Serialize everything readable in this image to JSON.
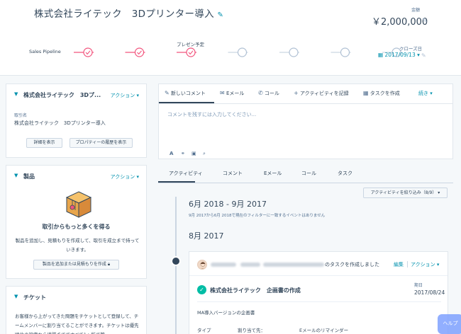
{
  "deal": {
    "title": "株式会社ライテック　3Dプリンター導入"
  },
  "amount": {
    "label": "金額",
    "value": "￥2,000,000"
  },
  "close_date": {
    "label": "クローズ日",
    "value": "2017/09/13"
  },
  "pipeline": {
    "label": "Sales Pipeline",
    "current_stage": "プレゼン予定",
    "stages_done": 3,
    "stages_total": 7
  },
  "deal_card": {
    "title": "株式会社ライテック　3Dプ...",
    "action": "アクション",
    "field_label": "取引名",
    "field_value": "株式会社ライテック　3Dプリンター導入",
    "btn_details": "詳細を表示",
    "btn_history": "プロパティーの履歴を表示"
  },
  "product_card": {
    "title": "製品",
    "action": "アクション",
    "empty_title": "取引からもっと多くを得る",
    "empty_desc": "製品を追加し、見積もりを作成して、取引を成立まで持っていきます。",
    "btn_add": "製品を追加または見積もりを作成"
  },
  "ticket_card": {
    "title": "チケット",
    "desc": "お客様から上がってきた問題をチケットとして登録して、チームメンバーに割り当てることができます。チケットは優先順位の設定から追跡までですべて1ヵ所で管"
  },
  "composer": {
    "tabs": [
      "新しいコメント",
      "Eメール",
      "コール",
      "アクティビティを記録",
      "タスクを作成",
      "続き"
    ],
    "placeholder": "コメントを残すには入力してください..."
  },
  "activity": {
    "tabs": [
      "アクティビティ",
      "コメント",
      "Eメール",
      "コール",
      "タスク"
    ],
    "filter": "アクティビティを絞り込み（8/9）",
    "period1": "6月 2018 - 9月 2017",
    "period1_note": "9月 2017から6月 2018で現在のフィルターに一致するイベントはありません",
    "period2": "8月 2017"
  },
  "task": {
    "action_text": "のタスクを作成しました",
    "edit": "編集",
    "actions": "アクション",
    "title": "株式会社ライテック　企画書の作成",
    "due_label": "期日",
    "due_value": "2017/08/24",
    "desc": "MA導入バージョンの企画書",
    "col_type": "タイプ",
    "col_assign": "割り当て先：",
    "col_reminder": "Eメールのリマインダー"
  },
  "help": {
    "label": "ヘルプ"
  },
  "colors": {
    "accent": "#0091ae",
    "stage_done": "#f2547d",
    "check": "#00bda5",
    "help": "#7fa2ff"
  }
}
